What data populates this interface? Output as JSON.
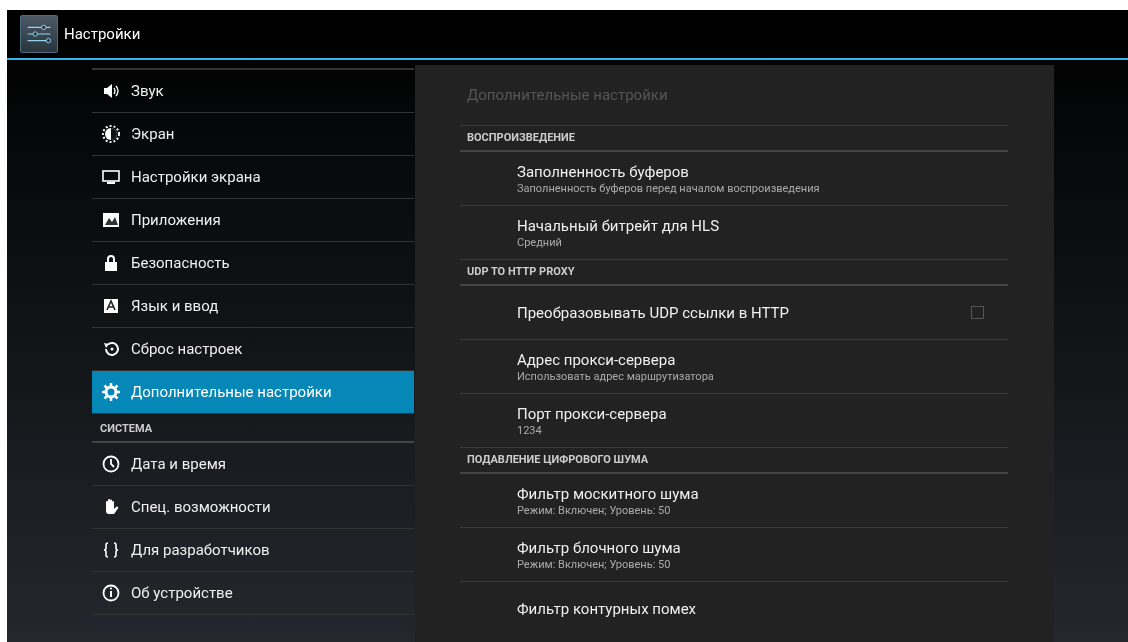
{
  "action_bar": {
    "title": "Настройки"
  },
  "sidebar": {
    "items": [
      {
        "kind": "item",
        "label": "Звук",
        "selected": false
      },
      {
        "kind": "item",
        "label": "Экран",
        "selected": false
      },
      {
        "kind": "item",
        "label": "Настройки экрана",
        "selected": false
      },
      {
        "kind": "item",
        "label": "Приложения",
        "selected": false
      },
      {
        "kind": "item",
        "label": "Безопасность",
        "selected": false
      },
      {
        "kind": "item",
        "label": "Язык и ввод",
        "selected": false
      },
      {
        "kind": "item",
        "label": "Сброс настроек",
        "selected": false
      },
      {
        "kind": "item",
        "label": "Дополнительные настройки",
        "selected": true
      },
      {
        "kind": "header",
        "label": "СИСТЕМА"
      },
      {
        "kind": "item",
        "label": "Дата и время",
        "selected": false
      },
      {
        "kind": "item",
        "label": "Спец. возможности",
        "selected": false
      },
      {
        "kind": "item",
        "label": "Для разработчиков",
        "selected": false
      },
      {
        "kind": "item",
        "label": "Об устройстве",
        "selected": false
      }
    ]
  },
  "panel": {
    "title": "Дополнительные настройки",
    "items": [
      {
        "kind": "header",
        "label": "ВОСПРОИЗВЕДЕНИЕ"
      },
      {
        "kind": "pref",
        "title": "Заполненность буферов",
        "summary": "Заполненность буферов перед началом воспроизведения"
      },
      {
        "kind": "pref",
        "title": "Начальный битрейт для HLS",
        "summary": "Средний"
      },
      {
        "kind": "header",
        "label": "UDP TO HTTP PROXY"
      },
      {
        "kind": "checkbox",
        "title": "Преобразовывать UDP ссылки в HTTP",
        "checked": false
      },
      {
        "kind": "pref",
        "title": "Адрес прокси-сервера",
        "summary": "Использовать адрес маршрутизатора"
      },
      {
        "kind": "pref",
        "title": "Порт прокси-сервера",
        "summary": "1234"
      },
      {
        "kind": "header",
        "label": "ПОДАВЛЕНИЕ ЦИФРОВОГО ШУМА"
      },
      {
        "kind": "pref",
        "title": "Фильтр москитного шума",
        "summary": "Режим: Включен; Уровень: 50"
      },
      {
        "kind": "pref",
        "title": "Фильтр блочного шума",
        "summary": "Режим: Включен; Уровень: 50"
      },
      {
        "kind": "pref",
        "title": "Фильтр контурных помех"
      }
    ]
  }
}
